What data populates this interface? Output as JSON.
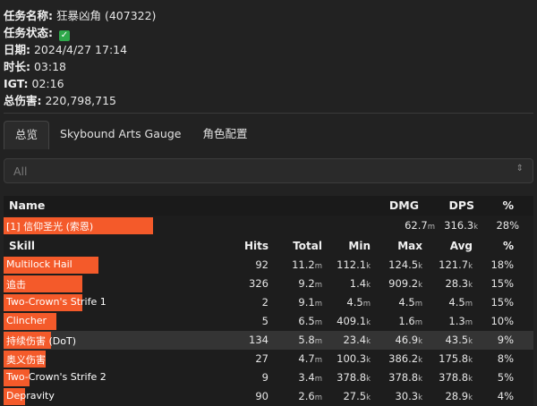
{
  "info": {
    "quest_label": "任务名称:",
    "quest_value": "狂暴凶角 (407322)",
    "status_label": "任务状态:",
    "status_icon": "check-icon",
    "date_label": "日期:",
    "date_value": "2024/4/27 17:14",
    "duration_label": "时长:",
    "duration_value": "03:18",
    "igt_label": "IGT:",
    "igt_value": "02:16",
    "damage_label": "总伤害:",
    "damage_value": "220,798,715"
  },
  "tabs": [
    {
      "label": "总览",
      "active": true
    },
    {
      "label": "Skybound Arts Gauge",
      "active": false
    },
    {
      "label": "角色配置",
      "active": false
    }
  ],
  "filter": {
    "selected": "All"
  },
  "colors": {
    "bar": "#f45a2a",
    "background": "#222222",
    "check": "#2ea84a"
  },
  "table": {
    "headers": {
      "name": "Name",
      "dmg": "DMG",
      "dps": "DPS",
      "pct": "%"
    },
    "player": {
      "name": "[1] 信仰圣光 (索恩)",
      "dmg": "62.7",
      "dmg_unit": "m",
      "dps": "316.3",
      "dps_unit": "k",
      "pct": "28%",
      "bar_fraction": 0.28
    },
    "skill_headers": {
      "skill": "Skill",
      "hits": "Hits",
      "total": "Total",
      "min": "Min",
      "max": "Max",
      "avg": "Avg",
      "pct": "%"
    },
    "skills": [
      {
        "name": "Multilock Hail",
        "hits": "92",
        "total": "11.2",
        "total_u": "m",
        "min": "112.1",
        "min_u": "k",
        "max": "124.5",
        "max_u": "k",
        "avg": "121.7",
        "avg_u": "k",
        "pct": "18%",
        "bar_fraction": 0.18
      },
      {
        "name": "追击",
        "hits": "326",
        "total": "9.2",
        "total_u": "m",
        "min": "1.4",
        "min_u": "k",
        "max": "909.2",
        "max_u": "k",
        "avg": "28.3",
        "avg_u": "k",
        "pct": "15%",
        "bar_fraction": 0.15
      },
      {
        "name": "Two-Crown's Strife 1",
        "hits": "2",
        "total": "9.1",
        "total_u": "m",
        "min": "4.5",
        "min_u": "m",
        "max": "4.5",
        "max_u": "m",
        "avg": "4.5",
        "avg_u": "m",
        "pct": "15%",
        "bar_fraction": 0.15
      },
      {
        "name": "Clincher",
        "hits": "5",
        "total": "6.5",
        "total_u": "m",
        "min": "409.1",
        "min_u": "k",
        "max": "1.6",
        "max_u": "m",
        "avg": "1.3",
        "avg_u": "m",
        "pct": "10%",
        "bar_fraction": 0.1
      },
      {
        "name": "持续伤害 (DoT)",
        "hits": "134",
        "total": "5.8",
        "total_u": "m",
        "min": "23.4",
        "min_u": "k",
        "max": "46.9",
        "max_u": "k",
        "avg": "43.5",
        "avg_u": "k",
        "pct": "9%",
        "bar_fraction": 0.09,
        "highlight": true
      },
      {
        "name": "奥义伤害",
        "hits": "27",
        "total": "4.7",
        "total_u": "m",
        "min": "100.3",
        "min_u": "k",
        "max": "386.2",
        "max_u": "k",
        "avg": "175.8",
        "avg_u": "k",
        "pct": "8%",
        "bar_fraction": 0.08
      },
      {
        "name": "Two-Crown's Strife 2",
        "hits": "9",
        "total": "3.4",
        "total_u": "m",
        "min": "378.8",
        "min_u": "k",
        "max": "378.8",
        "max_u": "k",
        "avg": "378.8",
        "avg_u": "k",
        "pct": "5%",
        "bar_fraction": 0.05
      },
      {
        "name": "Depravity",
        "hits": "90",
        "total": "2.6",
        "total_u": "m",
        "min": "27.5",
        "min_u": "k",
        "max": "30.3",
        "max_u": "k",
        "avg": "28.9",
        "avg_u": "k",
        "pct": "4%",
        "bar_fraction": 0.04
      }
    ]
  }
}
